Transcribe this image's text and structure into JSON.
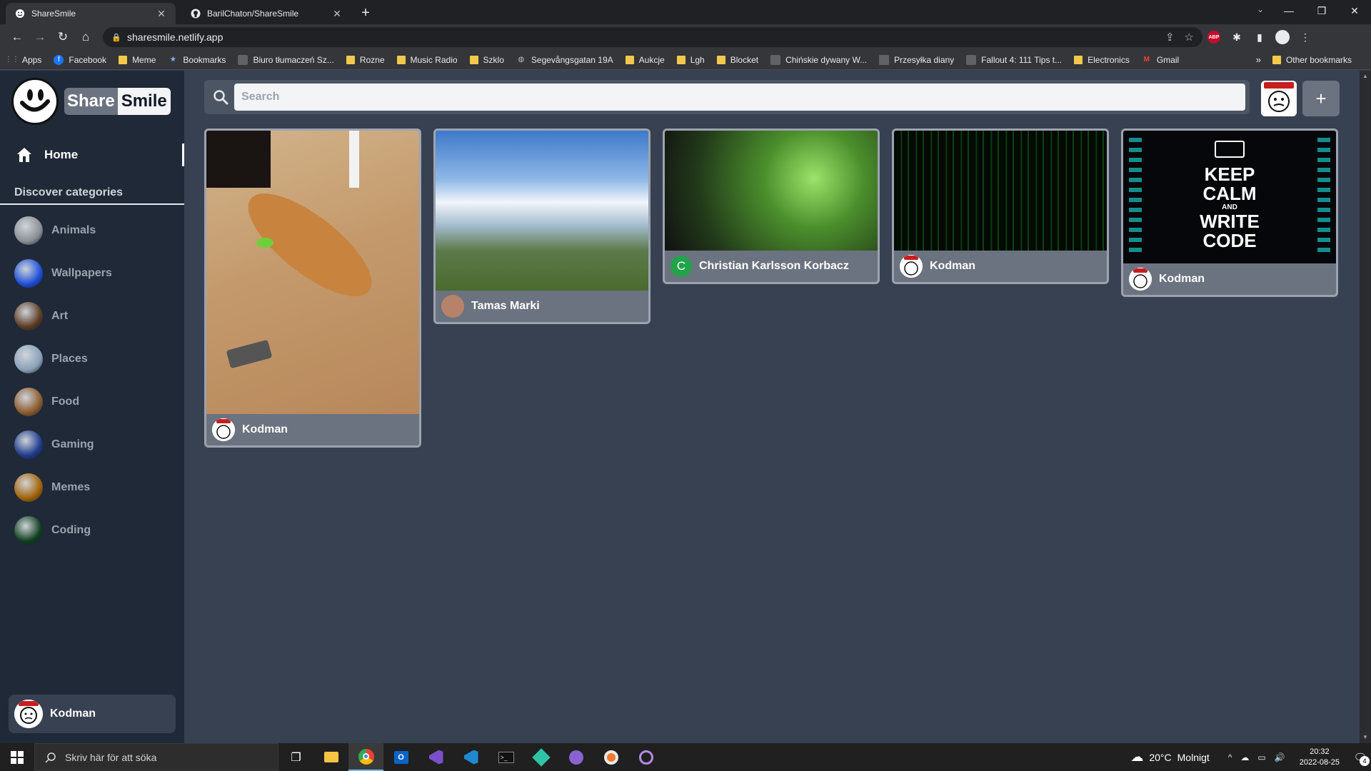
{
  "browser": {
    "tabs": [
      {
        "title": "ShareSmile",
        "active": true
      },
      {
        "title": "BarilChaton/ShareSmile",
        "active": false
      }
    ],
    "url": "sharesmile.netlify.app",
    "bookmarks": [
      {
        "label": "Apps",
        "icon": "apps-grid-icon"
      },
      {
        "label": "Facebook",
        "icon": "facebook-icon"
      },
      {
        "label": "Meme",
        "icon": "folder-icon"
      },
      {
        "label": "Bookmarks",
        "icon": "star-icon"
      },
      {
        "label": "Biuro tłumaczeń Sz...",
        "icon": "site-icon"
      },
      {
        "label": "Rozne",
        "icon": "folder-icon"
      },
      {
        "label": "Music Radio",
        "icon": "folder-icon"
      },
      {
        "label": "Szklo",
        "icon": "folder-icon"
      },
      {
        "label": "Segevångsgatan 19A",
        "icon": "globe-icon"
      },
      {
        "label": "Aukcje",
        "icon": "folder-icon"
      },
      {
        "label": "Lgh",
        "icon": "folder-icon"
      },
      {
        "label": "Blocket",
        "icon": "folder-icon"
      },
      {
        "label": "Chińskie dywany W...",
        "icon": "site-icon"
      },
      {
        "label": "Przesyłka diany",
        "icon": "site-icon"
      },
      {
        "label": "Fallout 4: 111 Tips t...",
        "icon": "site-icon"
      },
      {
        "label": "Electronics",
        "icon": "folder-icon"
      },
      {
        "label": "Gmail",
        "icon": "gmail-icon"
      }
    ],
    "more": "»",
    "other_bookmarks": "Other bookmarks"
  },
  "app": {
    "logo": {
      "word1": "Share",
      "word2": "Smile"
    },
    "nav": {
      "home": "Home"
    },
    "discover_title": "Discover categories",
    "categories": [
      {
        "label": "Animals",
        "color": "#8a8f94"
      },
      {
        "label": "Wallpapers",
        "color": "#1d4ed8"
      },
      {
        "label": "Art",
        "color": "#5b3a22"
      },
      {
        "label": "Places",
        "color": "#8aa0b8"
      },
      {
        "label": "Food",
        "color": "#8b5a2b"
      },
      {
        "label": "Gaming",
        "color": "#1e3a8a"
      },
      {
        "label": "Memes",
        "color": "#a16207"
      },
      {
        "label": "Coding",
        "color": "#0f3d1f"
      }
    ],
    "current_user": "Kodman",
    "search": {
      "placeholder": "Search",
      "value": ""
    },
    "add_label": "+",
    "pins": [
      {
        "author": "Kodman",
        "image": "cat-on-floor"
      },
      {
        "author": "Tamas Marki",
        "image": "mountain-landscape"
      },
      {
        "author": "Christian Karlsson Korbacz",
        "image": "warhammer-art",
        "initial": "C"
      },
      {
        "author": "Kodman",
        "image": "matrix-code"
      },
      {
        "author": "Kodman",
        "image": "keep-calm-write-code",
        "poster": {
          "line1": "KEEP",
          "line2": "CALM",
          "line3": "AND",
          "line4": "WRITE",
          "line5": "CODE"
        }
      }
    ]
  },
  "taskbar": {
    "search_placeholder": "Skriv här för att söka",
    "weather": {
      "temp": "20°C",
      "desc": "Molnigt"
    },
    "time": "20:32",
    "date": "2022-08-25",
    "notifications": "4"
  },
  "colors": {
    "accent": "#6b7280",
    "sidebar": "#1f2937",
    "background": "#374151"
  }
}
